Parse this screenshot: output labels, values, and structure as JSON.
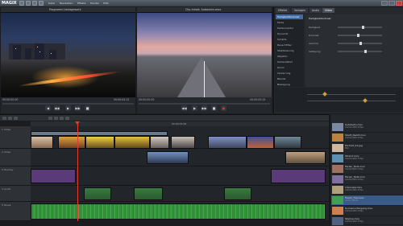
{
  "app": {
    "logo": "MAGIX",
    "menu": [
      "Datei",
      "Bearbeiten",
      "Effekte",
      "Fenster",
      "Hilfe"
    ],
    "colors": {
      "accent": "#3e6aa8",
      "record": "#e03030",
      "playhead": "#e04030"
    }
  },
  "monitor_left": {
    "title": "Programm-Vorlagewerk",
    "timecode_left": "00:00:00:00",
    "timecode_right": "00:00:04:12"
  },
  "monitor_right": {
    "title": "Clip-Inhalt: Autobahn.mov",
    "timecode_left": "00:00:00:00",
    "timecode_right": "00:00:05:15"
  },
  "fx_panel": {
    "tabs": [
      "Effekte",
      "Vorlagen",
      "Audio",
      "Video"
    ],
    "active_tab": "Video",
    "items": [
      "Helligkeit/Kontrast",
      "Farbe",
      "Farbkorrektur",
      "Dynamik",
      "Schärfe",
      "Rauschfilter",
      "Stabilisierung",
      "Objektiv",
      "Kamerafahrt",
      "Zoom",
      "Verzerrung",
      "Blende",
      "Bewegung"
    ],
    "selected_item": "Helligkeit/Kontrast",
    "settings_title": "Helligkeit/Kontrast",
    "sliders": [
      {
        "label": "Helligkeit",
        "value": 0.55
      },
      {
        "label": "Kontrast",
        "value": 0.45
      },
      {
        "label": "Gamma",
        "value": 0.5
      },
      {
        "label": "Sättigung",
        "value": 0.6
      }
    ]
  },
  "timeline": {
    "ruler_label": "00:00:05:00",
    "tracks": [
      {
        "label": "1 Video"
      },
      {
        "label": "2 Video"
      },
      {
        "label": "3 Overlay"
      },
      {
        "label": "4 Audio"
      },
      {
        "label": "5 Musik"
      }
    ]
  },
  "media_pool": {
    "items": [
      {
        "name": "Autobahn.mov",
        "sub": "1920x1080 25fps"
      },
      {
        "name": "Stadt_Nacht.mov",
        "sub": "1920x1080 25fps"
      },
      {
        "name": "Portrait_01.jpg",
        "sub": "Bild"
      },
      {
        "name": "Strand.mov",
        "sub": "1920x1080 25fps"
      },
      {
        "name": "Ferien_Teil1.mov",
        "sub": "1920x1080 25fps"
      },
      {
        "name": "Ferien_Teil2.mov",
        "sub": "1920x1080 25fps"
      },
      {
        "name": "Interview.mov",
        "sub": "1920x1080 25fps"
      },
      {
        "name": "Musik_Titel.wav",
        "sub": "Audio 48kHz"
      },
      {
        "name": "Sonnenuntergang.mov",
        "sub": "1920x1080 25fps"
      },
      {
        "name": "Skyline.mov",
        "sub": "1920x1080 25fps"
      }
    ]
  }
}
